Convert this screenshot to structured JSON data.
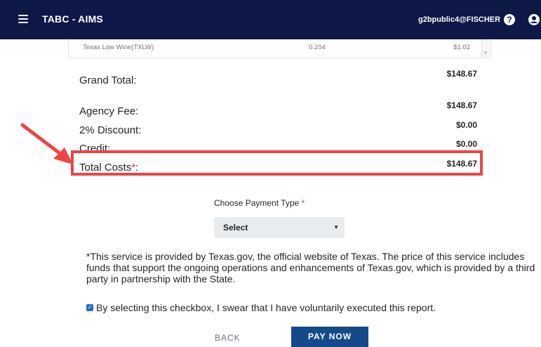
{
  "header": {
    "title": "TABC - AIMS",
    "user": "g2bpublic4@FISCHER",
    "help_symbol": "?"
  },
  "table": {
    "row": [
      "Texas Low Wine(TXLW)",
      "0.204",
      "$1.02"
    ]
  },
  "totals": {
    "grand_total_label": "Grand Total:",
    "grand_total_value": "$148.67",
    "agency_fee_label": "Agency Fee:",
    "agency_fee_value": "$148.67",
    "discount_label": "2% Discount:",
    "discount_value": "$0.00",
    "credit_label": "Credit:",
    "credit_value": "$0.00",
    "total_costs_label": "Total Costs",
    "total_costs_required": "*",
    "total_costs_suffix": ":",
    "total_costs_value": "$148.67"
  },
  "payment": {
    "label": "Choose Payment Type",
    "required_mark": "*",
    "selected": "Select"
  },
  "disclaimer": "*This service is provided by Texas.gov, the official website of Texas. The price of this service includes funds that support the ongoing operations and enhancements of Texas.gov, which is provided by a third party in partnership with the State.",
  "agreement": {
    "checked": true,
    "text": "By selecting this checkbox, I swear that I have voluntarily executed this report."
  },
  "buttons": {
    "back": "BACK",
    "pay_now": "PAY NOW"
  },
  "colors": {
    "header_bg": "#0d1847",
    "highlight": "#ef4444",
    "primary": "#154a8a"
  }
}
